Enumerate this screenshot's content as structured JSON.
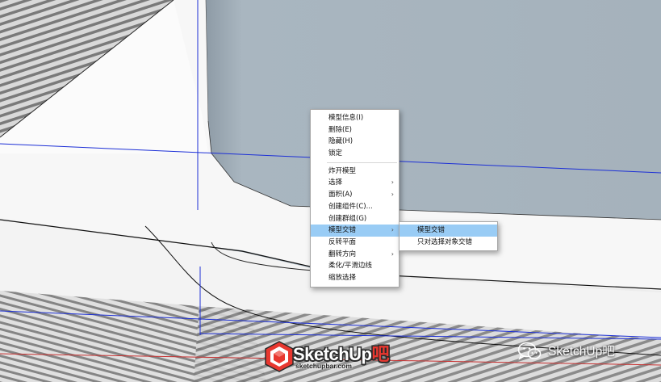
{
  "context_menu": {
    "items": [
      {
        "label": "模型信息(I)",
        "submenu": false
      },
      {
        "label": "删除(E)",
        "submenu": false
      },
      {
        "label": "隐藏(H)",
        "submenu": false
      },
      {
        "label": "锁定",
        "submenu": false
      },
      {
        "label": "炸开模型",
        "submenu": false
      },
      {
        "label": "选择",
        "submenu": true
      },
      {
        "label": "面积(A)",
        "submenu": true
      },
      {
        "label": "创建组件(C)...",
        "submenu": false
      },
      {
        "label": "创建群组(G)",
        "submenu": false
      },
      {
        "label": "模型交错",
        "submenu": true,
        "active": true
      },
      {
        "label": "反转平面",
        "submenu": false
      },
      {
        "label": "翻转方向",
        "submenu": true
      },
      {
        "label": "柔化/平滑边线",
        "submenu": false
      },
      {
        "label": "缩放选择",
        "submenu": false
      }
    ],
    "arrow_glyph": "›"
  },
  "submenu": {
    "items": [
      {
        "label": "模型交错",
        "active": true
      },
      {
        "label": "只对选择对象交错",
        "active": false
      }
    ]
  },
  "logo": {
    "text_main": "SketchUp",
    "text_accent": "吧",
    "url": "sketchupbar.com"
  },
  "watermark": {
    "text": "SketchUp吧"
  },
  "colors": {
    "wall": "#a6b3bd",
    "axis_blue": "#1c2fd6",
    "axis_red": "#c83030",
    "highlight": "#99ccf5",
    "logo_red": "#e8372f"
  }
}
